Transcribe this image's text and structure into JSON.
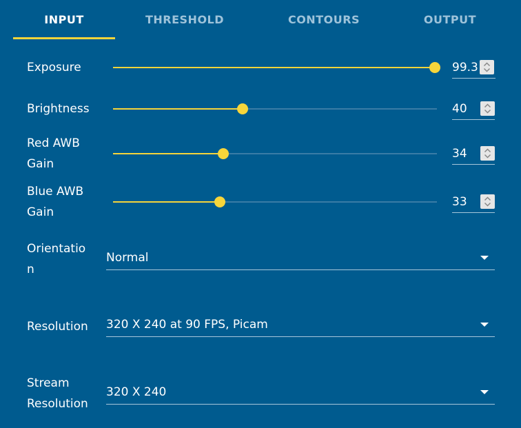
{
  "tabs": [
    {
      "label": "INPUT",
      "active": true
    },
    {
      "label": "THRESHOLD",
      "active": false
    },
    {
      "label": "CONTOURS",
      "active": false
    },
    {
      "label": "OUTPUT",
      "active": false
    }
  ],
  "colors": {
    "background": "#005b8f",
    "accent": "#f7d53a",
    "track": "#3a7ca6",
    "inactive_tab": "#9ec3da"
  },
  "sliders": [
    {
      "label_line1": "Exposure",
      "label_line2": "",
      "value": "99.3",
      "fraction": 0.993
    },
    {
      "label_line1": "Brightness",
      "label_line2": "",
      "value": "40",
      "fraction": 0.4
    },
    {
      "label_line1": "Red AWB",
      "label_line2": "Gain",
      "value": "34",
      "fraction": 0.34
    },
    {
      "label_line1": "Blue AWB",
      "label_line2": "Gain",
      "value": "33",
      "fraction": 0.33
    }
  ],
  "selects": [
    {
      "label_line1": "Orientatio",
      "label_line2": "n",
      "value": "Normal"
    },
    {
      "label_line1": "Resolution",
      "label_line2": "",
      "value": "320 X 240 at 90 FPS, Picam"
    },
    {
      "label_line1": "Stream",
      "label_line2": "Resolution",
      "value": "320 X 240"
    }
  ],
  "icons": {
    "stepper": "up-down-chevron-icon",
    "dropdown": "caret-down-icon"
  }
}
